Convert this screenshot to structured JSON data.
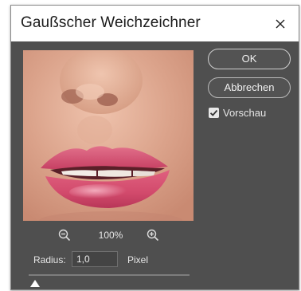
{
  "dialog": {
    "title": "Gaußscher Weichzeichner"
  },
  "buttons": {
    "ok_label": "OK",
    "cancel_label": "Abbrechen"
  },
  "preview_toggle": {
    "label": "Vorschau",
    "checked": true
  },
  "zoom": {
    "level": "100%"
  },
  "radius": {
    "label": "Radius:",
    "value": "1,0",
    "unit": "Pixel",
    "slider_fraction": 0.04
  },
  "colors": {
    "dialog_bg": "#4f4f4f",
    "titlebar_bg": "#ffffff",
    "skin": "#d89e86",
    "lips": "#d8506f"
  },
  "icons": {
    "close": "close-icon",
    "zoom_out": "zoom-out-icon",
    "zoom_in": "zoom-in-icon",
    "checkmark": "checkmark-icon",
    "slider": "slider-thumb-icon"
  }
}
